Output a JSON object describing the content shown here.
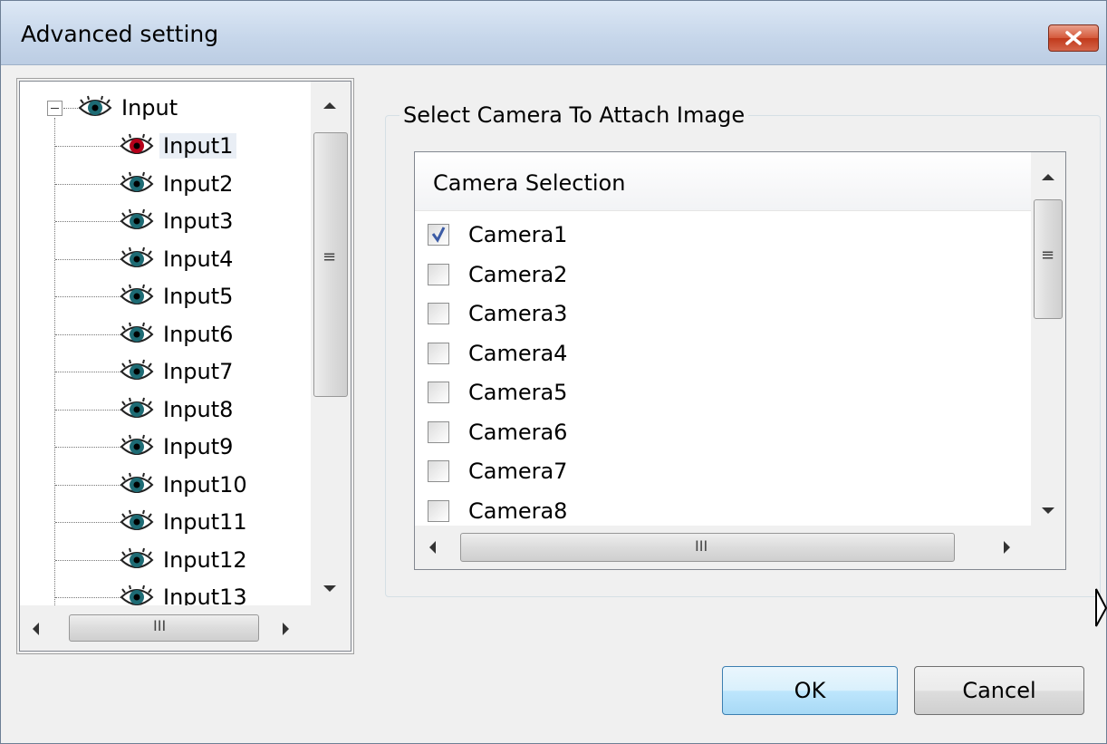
{
  "window": {
    "title": "Advanced setting"
  },
  "tree": {
    "root_label": "Input",
    "items": [
      {
        "label": "Input1",
        "selected": true
      },
      {
        "label": "Input2"
      },
      {
        "label": "Input3"
      },
      {
        "label": "Input4"
      },
      {
        "label": "Input5"
      },
      {
        "label": "Input6"
      },
      {
        "label": "Input7"
      },
      {
        "label": "Input8"
      },
      {
        "label": "Input9"
      },
      {
        "label": "Input10"
      },
      {
        "label": "Input11"
      },
      {
        "label": "Input12"
      },
      {
        "label": "Input13"
      }
    ],
    "icons": {
      "item": "eye-icon",
      "root": "eye-icon",
      "expander": "minus-box-icon"
    }
  },
  "group": {
    "title": "Select Camera To Attach Image"
  },
  "camera_list": {
    "header": "Camera Selection",
    "items": [
      {
        "label": "Camera1",
        "checked": true
      },
      {
        "label": "Camera2",
        "checked": false
      },
      {
        "label": "Camera3",
        "checked": false
      },
      {
        "label": "Camera4",
        "checked": false
      },
      {
        "label": "Camera5",
        "checked": false
      },
      {
        "label": "Camera6",
        "checked": false
      },
      {
        "label": "Camera7",
        "checked": false
      },
      {
        "label": "Camera8",
        "checked": false
      }
    ]
  },
  "buttons": {
    "ok": "OK",
    "cancel": "Cancel"
  },
  "colors": {
    "title_bar": "#c6d6ea",
    "close_button": "#c1391b",
    "ok_button": "#bee6fd",
    "check_mark": "#3b5ba5",
    "selected_eye": "#b5001a"
  }
}
